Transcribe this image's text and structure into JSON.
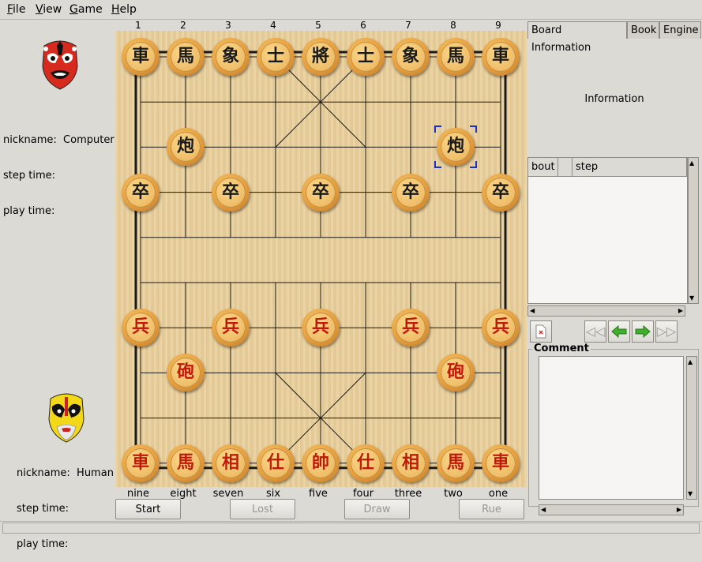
{
  "menu": [
    "File",
    "View",
    "Game",
    "Help"
  ],
  "top_player": {
    "nickname_label": "nickname:",
    "nickname": "Computer",
    "step_time_label": "step time:",
    "play_time_label": "play time:"
  },
  "bottom_player": {
    "nickname_label": "nickname:",
    "nickname": "Human",
    "step_time_label": "step time:",
    "play_time_label": "play time:"
  },
  "columns_top": [
    "1",
    "2",
    "3",
    "4",
    "5",
    "6",
    "7",
    "8",
    "9"
  ],
  "columns_bottom": [
    "nine",
    "eight",
    "seven",
    "six",
    "five",
    "four",
    "three",
    "two",
    "one"
  ],
  "pieces": [
    {
      "ch": "車",
      "side": "black",
      "file": 0,
      "rank": 0
    },
    {
      "ch": "馬",
      "side": "black",
      "file": 1,
      "rank": 0
    },
    {
      "ch": "象",
      "side": "black",
      "file": 2,
      "rank": 0
    },
    {
      "ch": "士",
      "side": "black",
      "file": 3,
      "rank": 0
    },
    {
      "ch": "將",
      "side": "black",
      "file": 4,
      "rank": 0
    },
    {
      "ch": "士",
      "side": "black",
      "file": 5,
      "rank": 0
    },
    {
      "ch": "象",
      "side": "black",
      "file": 6,
      "rank": 0
    },
    {
      "ch": "馬",
      "side": "black",
      "file": 7,
      "rank": 0
    },
    {
      "ch": "車",
      "side": "black",
      "file": 8,
      "rank": 0
    },
    {
      "ch": "炮",
      "side": "black",
      "file": 1,
      "rank": 2
    },
    {
      "ch": "炮",
      "side": "black",
      "file": 7,
      "rank": 2,
      "selected": true
    },
    {
      "ch": "卒",
      "side": "black",
      "file": 0,
      "rank": 3
    },
    {
      "ch": "卒",
      "side": "black",
      "file": 2,
      "rank": 3
    },
    {
      "ch": "卒",
      "side": "black",
      "file": 4,
      "rank": 3
    },
    {
      "ch": "卒",
      "side": "black",
      "file": 6,
      "rank": 3
    },
    {
      "ch": "卒",
      "side": "black",
      "file": 8,
      "rank": 3
    },
    {
      "ch": "兵",
      "side": "red",
      "file": 0,
      "rank": 6
    },
    {
      "ch": "兵",
      "side": "red",
      "file": 2,
      "rank": 6
    },
    {
      "ch": "兵",
      "side": "red",
      "file": 4,
      "rank": 6
    },
    {
      "ch": "兵",
      "side": "red",
      "file": 6,
      "rank": 6
    },
    {
      "ch": "兵",
      "side": "red",
      "file": 8,
      "rank": 6
    },
    {
      "ch": "砲",
      "side": "red",
      "file": 1,
      "rank": 7
    },
    {
      "ch": "砲",
      "side": "red",
      "file": 7,
      "rank": 7
    },
    {
      "ch": "車",
      "side": "red",
      "file": 0,
      "rank": 9
    },
    {
      "ch": "馬",
      "side": "red",
      "file": 1,
      "rank": 9
    },
    {
      "ch": "相",
      "side": "red",
      "file": 2,
      "rank": 9
    },
    {
      "ch": "仕",
      "side": "red",
      "file": 3,
      "rank": 9
    },
    {
      "ch": "帥",
      "side": "red",
      "file": 4,
      "rank": 9
    },
    {
      "ch": "仕",
      "side": "red",
      "file": 5,
      "rank": 9
    },
    {
      "ch": "相",
      "side": "red",
      "file": 6,
      "rank": 9
    },
    {
      "ch": "馬",
      "side": "red",
      "file": 7,
      "rank": 9
    },
    {
      "ch": "車",
      "side": "red",
      "file": 8,
      "rank": 9
    }
  ],
  "buttons": {
    "start": "Start",
    "lost": "Lost",
    "draw": "Draw",
    "rue": "Rue"
  },
  "tabs": [
    "Board Information",
    "Book",
    "Engine"
  ],
  "info_label": "Information",
  "movelist": {
    "col_bout": "bout",
    "col_step": "step"
  },
  "comment_label": "Comment",
  "colors": {
    "board": "#e9cf9b",
    "black_piece_text": "#1a1a1a",
    "red_piece_text": "#c01a0a",
    "selection": "#1a2fd0"
  }
}
